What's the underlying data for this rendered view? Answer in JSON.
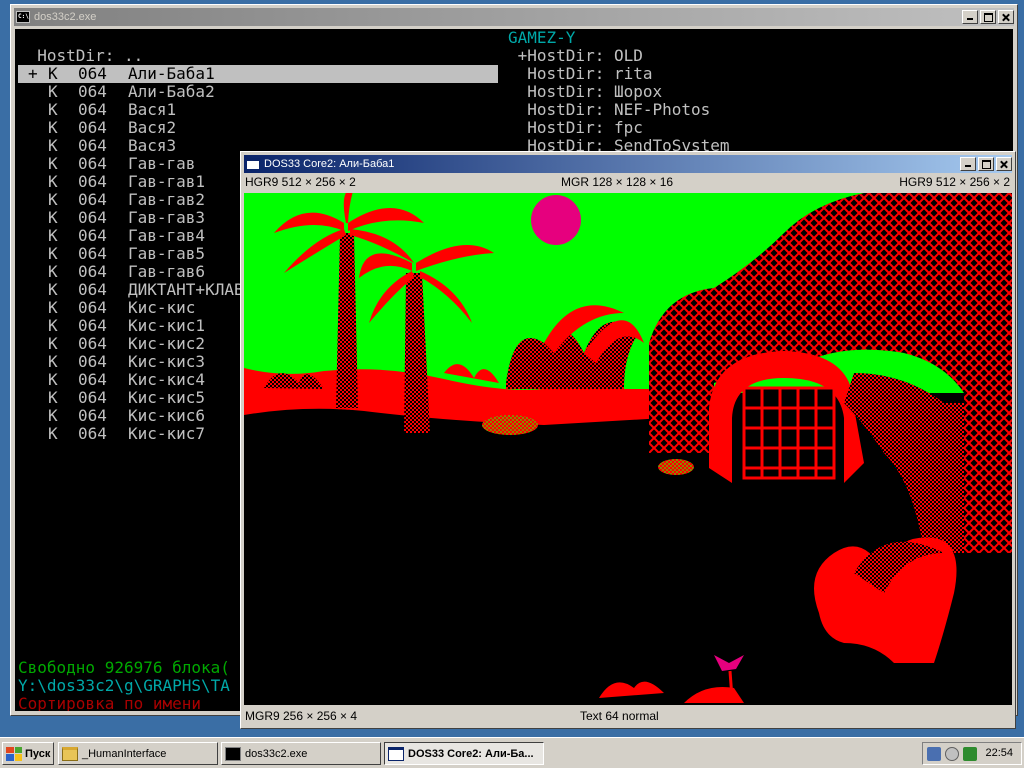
{
  "console": {
    "title": "dos33c2.exe",
    "left_panel": {
      "title": "GAMEZ-Y",
      "parent_row": "  HostDir: ..",
      "files": [
        {
          "mark": "+",
          "type": "K",
          "size": "064",
          "name": "Али-Баба1"
        },
        {
          "mark": " ",
          "type": "K",
          "size": "064",
          "name": "Али-Баба2"
        },
        {
          "mark": " ",
          "type": "K",
          "size": "064",
          "name": "Вася1"
        },
        {
          "mark": " ",
          "type": "K",
          "size": "064",
          "name": "Вася2"
        },
        {
          "mark": " ",
          "type": "K",
          "size": "064",
          "name": "Вася3"
        },
        {
          "mark": " ",
          "type": "K",
          "size": "064",
          "name": "Гав-гав"
        },
        {
          "mark": " ",
          "type": "K",
          "size": "064",
          "name": "Гав-гав1"
        },
        {
          "mark": " ",
          "type": "K",
          "size": "064",
          "name": "Гав-гав2"
        },
        {
          "mark": " ",
          "type": "K",
          "size": "064",
          "name": "Гав-гав3"
        },
        {
          "mark": " ",
          "type": "K",
          "size": "064",
          "name": "Гав-гав4"
        },
        {
          "mark": " ",
          "type": "K",
          "size": "064",
          "name": "Гав-гав5"
        },
        {
          "mark": " ",
          "type": "K",
          "size": "064",
          "name": "Гав-гав6"
        },
        {
          "mark": " ",
          "type": "K",
          "size": "064",
          "name": "ДИКТАНТ+КЛАВ"
        },
        {
          "mark": " ",
          "type": "K",
          "size": "064",
          "name": "Кис-кис"
        },
        {
          "mark": " ",
          "type": "K",
          "size": "064",
          "name": "Кис-кис1"
        },
        {
          "mark": " ",
          "type": "K",
          "size": "064",
          "name": "Кис-кис2"
        },
        {
          "mark": " ",
          "type": "K",
          "size": "064",
          "name": "Кис-кис3"
        },
        {
          "mark": " ",
          "type": "K",
          "size": "064",
          "name": "Кис-кис4"
        },
        {
          "mark": " ",
          "type": "K",
          "size": "064",
          "name": "Кис-кис5"
        },
        {
          "mark": " ",
          "type": "K",
          "size": "064",
          "name": "Кис-кис6"
        },
        {
          "mark": " ",
          "type": "K",
          "size": "064",
          "name": "Кис-кис7"
        }
      ],
      "free_space": "Свободно 926976 блока(",
      "path": "Y:\\dos33c2\\g\\GRAPHS\\TA",
      "sort_mode": "Сортировка по имени"
    },
    "right_panel": {
      "title": "GAMEZ-Y",
      "rows": [
        " +HostDir: OLD",
        "  HostDir: rita",
        "  HostDir: Шорох",
        "  HostDir: NEF-Photos",
        "  HostDir: fpc",
        "  HostDir: SendToSystem"
      ]
    }
  },
  "emulator": {
    "title": "DOS33 Core2: Али-Баба1",
    "top_status": {
      "left": "HGR9 512 × 256 ×  2",
      "center": "MGR  128 × 128 × 16",
      "right": "HGR9 512 × 256 ×  2"
    },
    "bottom_status": {
      "left": "MGR9 256 × 256 ×  4",
      "center": "Text 64 normal"
    },
    "palette": {
      "green": "#00ff00",
      "red": "#ff0000",
      "magenta": "#e6007e",
      "black": "#000000"
    }
  },
  "taskbar": {
    "start_label": "Пуск",
    "tasks": [
      {
        "label": "_HumanInterface",
        "icon": "folder-icon",
        "pressed": false
      },
      {
        "label": "dos33c2.exe",
        "icon": "console-icon",
        "pressed": false
      },
      {
        "label": "DOS33 Core2: Али-Ба...",
        "icon": "app-window-icon",
        "pressed": true
      }
    ],
    "clock": "22:54"
  }
}
